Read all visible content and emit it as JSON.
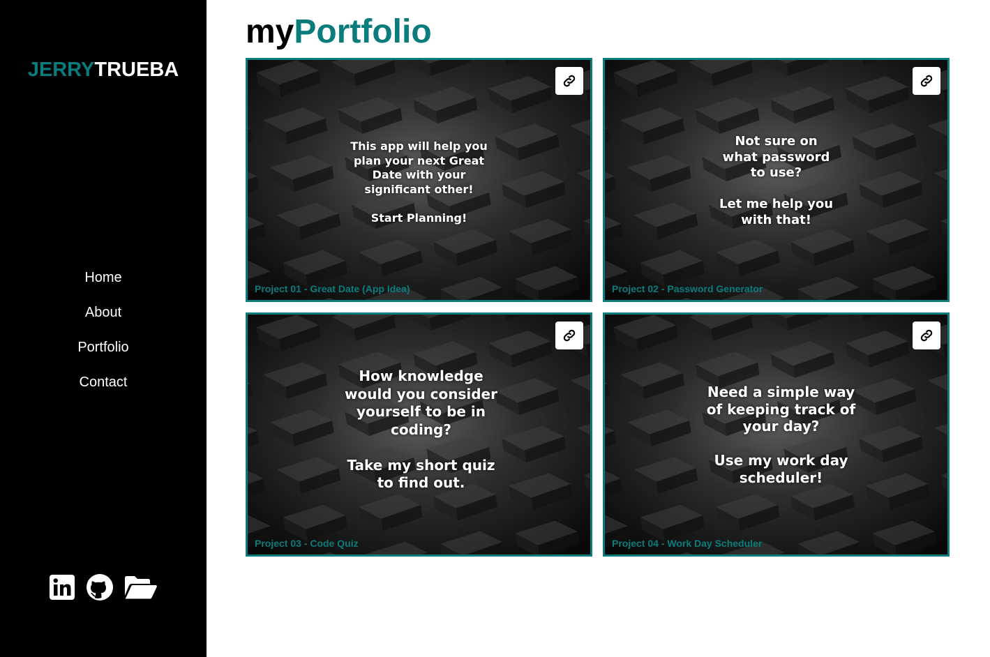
{
  "sidebar": {
    "brand_first": "JERRY",
    "brand_last": "TRUEBA",
    "nav": [
      {
        "label": "Home"
      },
      {
        "label": "About"
      },
      {
        "label": "Portfolio"
      },
      {
        "label": "Contact"
      }
    ],
    "social_icons": [
      "linkedin-icon",
      "github-icon",
      "folder-open-icon"
    ]
  },
  "main": {
    "title_prefix": "my",
    "title_main": "Portfolio",
    "projects": [
      {
        "caption": "Project 01 - Great Date (App Idea)",
        "message": "This app will help you\nplan your next Great\nDate with your\nsignificant other!\n\nStart Planning!",
        "icon": "link-icon"
      },
      {
        "caption": "Project 02 - Password Generator",
        "message": "Not sure on\nwhat password\nto use?\n\nLet me help you\nwith that!",
        "icon": "link-icon"
      },
      {
        "caption": "Project 03 - Code Quiz",
        "message": "How knowledge\nwould you consider\nyourself to be in\ncoding?\n\nTake my short quiz\nto find out.",
        "icon": "link-icon"
      },
      {
        "caption": "Project 04 - Work Day Scheduler",
        "message": "Need a simple way\nof keeping track of\nyour day?\n\nUse my work day\nscheduler!",
        "icon": "link-icon"
      }
    ]
  },
  "colors": {
    "accent": "#0b7c7c",
    "sidebar_bg": "#000000",
    "text_light": "#ffffff"
  }
}
